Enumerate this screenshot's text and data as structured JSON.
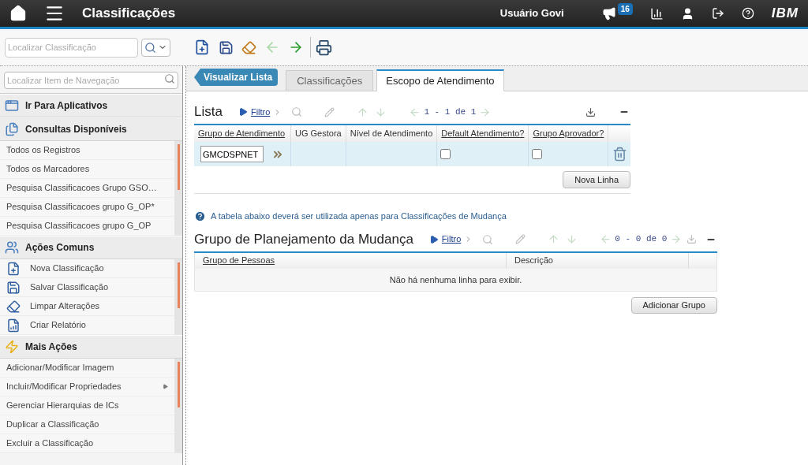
{
  "header": {
    "title": "Classificações",
    "user": "Usuário Govi",
    "badge": "16",
    "brand": "IBM"
  },
  "toolbar": {
    "search": {
      "placeholder": "Localizar Classificação"
    }
  },
  "sidebar": {
    "search": {
      "placeholder": "Localizar Item de Navegação"
    },
    "sections": [
      {
        "title": "Ir Para Aplicativos",
        "kind": "link"
      },
      {
        "title": "Consultas Disponíveis",
        "kind": "list",
        "items": [
          {
            "label": "Todos os Registros",
            "has_submenu": false
          },
          {
            "label": "Todos os Marcadores",
            "has_submenu": false
          },
          {
            "label": "Pesquisa Classificacoes Grupo GSO…",
            "has_submenu": false
          },
          {
            "label": "Pesquisa Classificacoes grupo G_OP*",
            "has_submenu": false
          },
          {
            "label": "Pesquisa Classificacoes grupo G_OP",
            "has_submenu": false
          }
        ]
      },
      {
        "title": "Ações Comuns",
        "kind": "actions",
        "items": [
          {
            "label": "Nova Classificação",
            "has_submenu": false
          },
          {
            "label": "Salvar Classificação",
            "has_submenu": false
          },
          {
            "label": "Limpar Alterações",
            "has_submenu": false
          },
          {
            "label": "Criar Relatório",
            "has_submenu": false
          }
        ]
      },
      {
        "title": "Mais Ações",
        "kind": "list",
        "items": [
          {
            "label": "Adicionar/Modificar Imagem",
            "has_submenu": false
          },
          {
            "label": "Incluir/Modificar Propriedades",
            "has_submenu": true
          },
          {
            "label": "Gerenciar Hierarquias de ICs",
            "has_submenu": false
          },
          {
            "label": "Duplicar a Classificação",
            "has_submenu": false
          },
          {
            "label": "Excluir a Classificação",
            "has_submenu": false
          }
        ]
      }
    ]
  },
  "main": {
    "back_button": "Visualizar Lista",
    "tabs": [
      {
        "label": "Classificações",
        "selected": false
      },
      {
        "label": "Escopo de Atendimento",
        "selected": true
      }
    ],
    "list_section": {
      "title": "Lista",
      "filter": "Filtro",
      "pager": "1 - 1 de 1",
      "columns": [
        {
          "label": "Grupo de Atendimento",
          "link": true
        },
        {
          "label": "UG Gestora",
          "link": false
        },
        {
          "label": "Nível de Atendimento",
          "link": false
        },
        {
          "label": "Default Atendimento?",
          "link": true
        },
        {
          "label": "Grupo Aprovador?",
          "link": true
        }
      ],
      "rows": [
        {
          "group": "GMCDSPNET",
          "default_checked": false,
          "approver_checked": false
        }
      ],
      "button": "Nova Linha"
    },
    "info": "A tabela abaixo deverá ser utilizada apenas para Classificações de Mudança",
    "planning_section": {
      "title": "Grupo de Planejamento da Mudança",
      "filter": "Filtro",
      "pager": "0 - 0 de 0",
      "columns": [
        {
          "label": "Grupo de Pessoas",
          "link": true
        },
        {
          "label": "Descrição",
          "link": false
        }
      ],
      "empty_message": "Não há nenhuma linha para exibir.",
      "button": "Adicionar Grupo"
    }
  }
}
